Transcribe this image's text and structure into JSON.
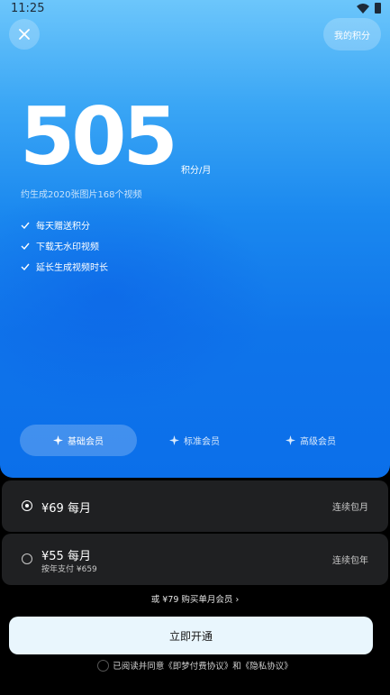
{
  "status_bar": {
    "time": "11:25"
  },
  "header": {
    "my_points_label": "我的积分"
  },
  "hero": {
    "points_value": "505",
    "points_unit": "积分/月",
    "estimate": "约生成2020张图片168个视频",
    "features": [
      "每天赠送积分",
      "下载无水印视频",
      "延长生成视频时长"
    ]
  },
  "tiers": [
    {
      "label": "基础会员",
      "active": true
    },
    {
      "label": "标准会员",
      "active": false
    },
    {
      "label": "高级会员",
      "active": false
    }
  ],
  "plans": [
    {
      "price": "¥69 每月",
      "type": "连续包月",
      "selected": true
    },
    {
      "price": "¥55 每月",
      "sub": "按年支付 ¥659",
      "type": "连续包年",
      "selected": false
    }
  ],
  "single_month_link": "或 ¥79 购买单月会员 ›",
  "cta_label": "立即开通",
  "agreement": "已阅读并同意《即梦付费协议》和《隐私协议》",
  "colors": {
    "accent_blue": "#0f74ea",
    "card_bg": "#1f2022",
    "cta_bg": "#e9f6fd"
  }
}
